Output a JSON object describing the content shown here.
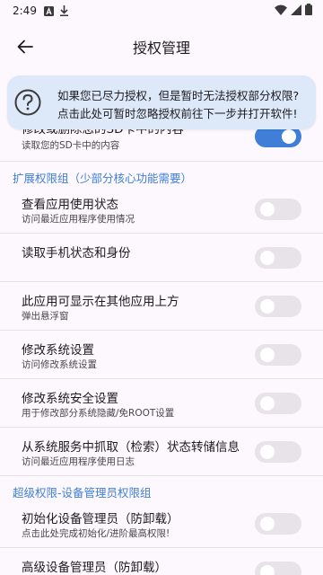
{
  "status_bar": {
    "time": "2:49"
  },
  "app_bar": {
    "title": "授权管理"
  },
  "banner": {
    "line1": "如果您已尽力授权，但是暂时无法授权部分权限?",
    "line2": "点击此处可暂时忽略授权前往下一步并打开软件!"
  },
  "top_item": {
    "title": "修改或删除您的SD卡中的内容",
    "subtitle": "读取您的SD卡中的内容",
    "enabled": true
  },
  "sections": {
    "extended": "扩展权限组（少部分核心功能需要）",
    "super": "超级权限-设备管理员权限组"
  },
  "extended_items": [
    {
      "title": "查看应用使用状态",
      "subtitle": "访问最近应用程序使用情况",
      "enabled": false
    },
    {
      "title": "读取手机状态和身份",
      "subtitle": "",
      "enabled": false
    },
    {
      "title": "此应用可显示在其他应用上方",
      "subtitle": "弹出悬浮窗",
      "enabled": false
    },
    {
      "title": "修改系统设置",
      "subtitle": "访问修改系统设置",
      "enabled": false
    },
    {
      "title": "修改系统安全设置",
      "subtitle": "用于修改部分系统隐藏/免ROOT设置",
      "enabled": false
    },
    {
      "title": "从系统服务中抓取（检索）状态转储信息",
      "subtitle": "访问最近应用程序使用日志",
      "enabled": false
    }
  ],
  "super_items": [
    {
      "title": "初始化设备管理员（防卸载）",
      "subtitle": "点击此处完成初始化/进阶最高权限!",
      "enabled": false
    },
    {
      "title": "高级设备管理员（防卸载）",
      "subtitle": "",
      "enabled": false
    }
  ],
  "colors": {
    "accent": "#3f7fd8",
    "banner_bg": "#dde9f8",
    "background": "#fdf8fd",
    "toggle_off": "#e8e3e9"
  }
}
